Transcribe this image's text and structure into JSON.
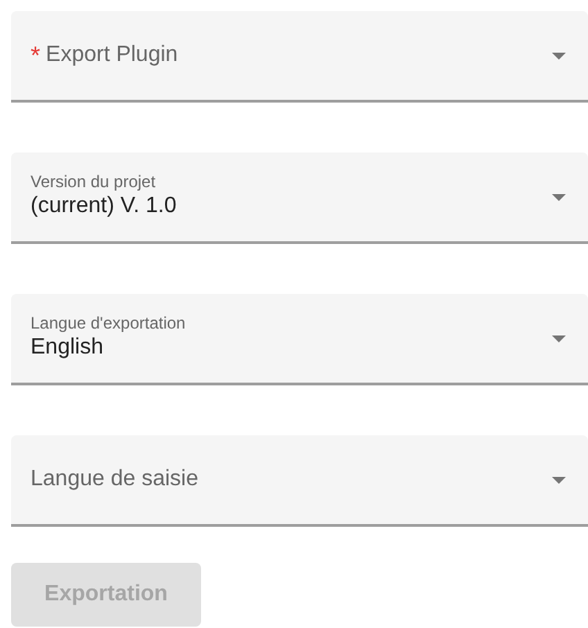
{
  "fields": [
    {
      "required_mark": "*",
      "placeholder": "Export Plugin"
    },
    {
      "label": "Version du projet",
      "value": "(current) V. 1.0"
    },
    {
      "label": "Langue d'exportation",
      "value": "English"
    },
    {
      "placeholder": "Langue de saisie"
    }
  ],
  "button": {
    "label": "Exportation",
    "disabled": true
  }
}
